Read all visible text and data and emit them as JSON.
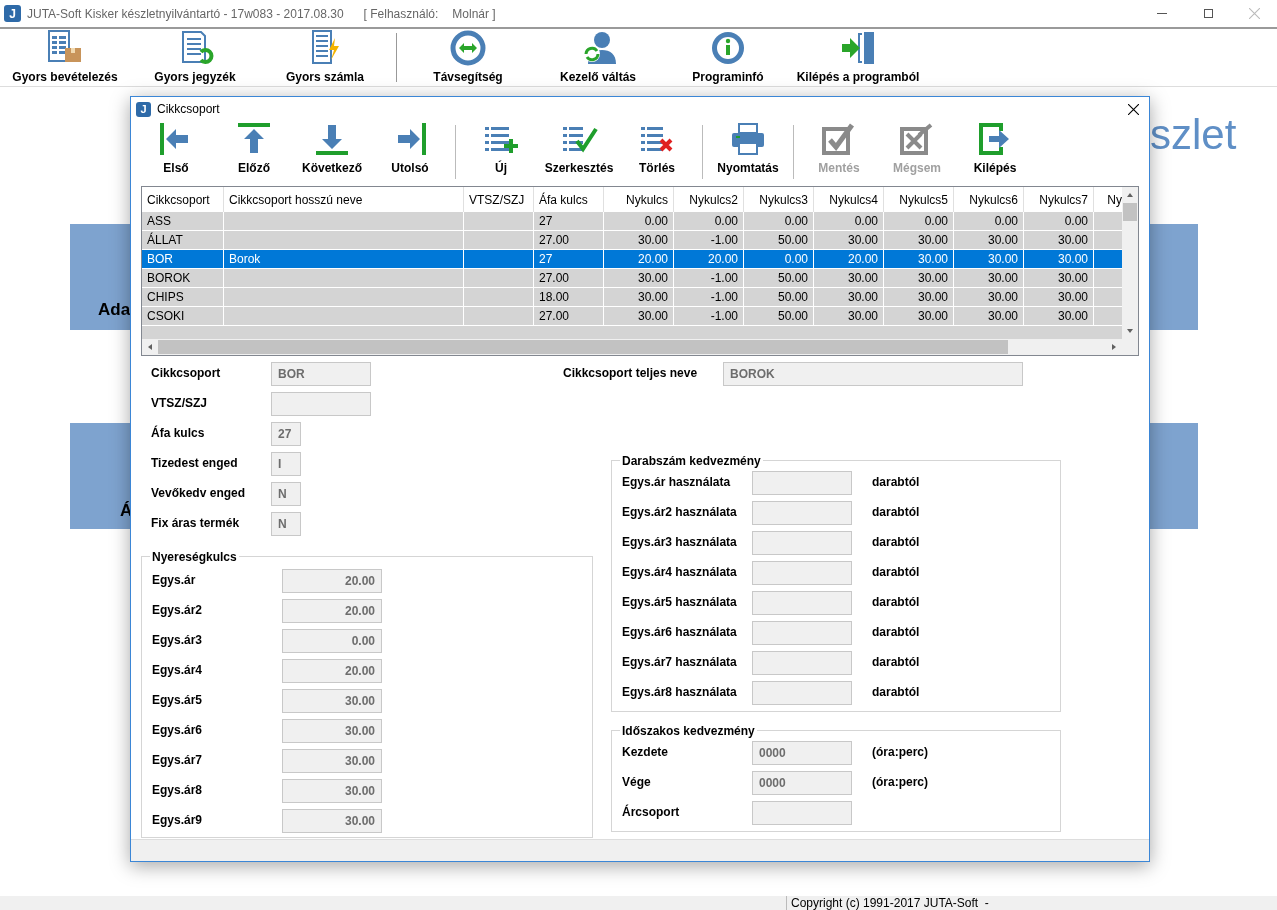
{
  "window": {
    "logo": "J",
    "title": "JUTA-Soft Kisker készletnyilvántartó - 17w083 - 2017.08.30",
    "user_label": "[ Felhasználó:",
    "user_name": "Molnár ]"
  },
  "toolbar": [
    {
      "label": "Gyors bevételezés",
      "kind": "receive",
      "separator_before": false
    },
    {
      "label": "Gyors jegyzék",
      "kind": "list",
      "separator_before": false
    },
    {
      "label": "Gyors számla",
      "kind": "invoice",
      "separator_before": false
    },
    {
      "label": "Távsegítség",
      "kind": "remote",
      "separator_before": true
    },
    {
      "label": "Kezelő váltás",
      "kind": "user",
      "separator_before": false
    },
    {
      "label": "Programinfó",
      "kind": "info",
      "separator_before": false
    },
    {
      "label": "Kilépés a programból",
      "kind": "exit",
      "separator_before": false
    }
  ],
  "background": {
    "heading_fragment": "szlet",
    "panels": [
      "Ada",
      "Á"
    ]
  },
  "dialog": {
    "logo": "J",
    "title": "Cikkcsoport",
    "toolbar": [
      {
        "label": "Első",
        "kind": "first",
        "disabled": false,
        "separator_before": false
      },
      {
        "label": "Előző",
        "kind": "prev",
        "disabled": false,
        "separator_before": false
      },
      {
        "label": "Következő",
        "kind": "next",
        "disabled": false,
        "separator_before": false
      },
      {
        "label": "Utolsó",
        "kind": "last",
        "disabled": false,
        "separator_before": false
      },
      {
        "label": "Új",
        "kind": "new",
        "disabled": false,
        "separator_before": true
      },
      {
        "label": "Szerkesztés",
        "kind": "edit",
        "disabled": false,
        "separator_before": false
      },
      {
        "label": "Törlés",
        "kind": "delete",
        "disabled": false,
        "separator_before": false
      },
      {
        "label": "Nyomtatás",
        "kind": "print",
        "disabled": false,
        "separator_before": true
      },
      {
        "label": "Mentés",
        "kind": "save",
        "disabled": true,
        "separator_before": true
      },
      {
        "label": "Mégsem",
        "kind": "cancel",
        "disabled": true,
        "separator_before": false
      },
      {
        "label": "Kilépés",
        "kind": "exit",
        "disabled": false,
        "separator_before": false
      }
    ],
    "table": {
      "columns": [
        "Cikkcsoport",
        "Cikkcsoport hosszú neve",
        "VTSZ/SZJ",
        "Áfa kulcs",
        "Nykulcs",
        "Nykulcs2",
        "Nykulcs3",
        "Nykulcs4",
        "Nykulcs5",
        "Nykulcs6",
        "Nykulcs7",
        "Ny"
      ],
      "rows": [
        {
          "selected": false,
          "cells": [
            "ASS",
            null,
            null,
            "27",
            "0.00",
            "0.00",
            "0.00",
            "0.00",
            "0.00",
            "0.00",
            "0.00",
            null
          ]
        },
        {
          "selected": false,
          "cells": [
            "ÁLLAT",
            null,
            null,
            "27.00",
            "30.00",
            "-1.00",
            "50.00",
            "30.00",
            "30.00",
            "30.00",
            "30.00",
            null
          ]
        },
        {
          "selected": true,
          "cells": [
            "BOR",
            "Borok",
            null,
            "27",
            "20.00",
            "20.00",
            "0.00",
            "20.00",
            "30.00",
            "30.00",
            "30.00",
            null
          ]
        },
        {
          "selected": false,
          "cells": [
            "BOROK",
            null,
            null,
            "27.00",
            "30.00",
            "-1.00",
            "50.00",
            "30.00",
            "30.00",
            "30.00",
            "30.00",
            null
          ]
        },
        {
          "selected": false,
          "cells": [
            "CHIPS",
            null,
            null,
            "18.00",
            "30.00",
            "-1.00",
            "50.00",
            "30.00",
            "30.00",
            "30.00",
            "30.00",
            null
          ]
        },
        {
          "selected": false,
          "cells": [
            "CSOKI",
            null,
            null,
            "27.00",
            "30.00",
            "-1.00",
            "50.00",
            "30.00",
            "30.00",
            "30.00",
            "30.00",
            null
          ]
        }
      ]
    },
    "fields": [
      {
        "label": "Cikkcsoport",
        "value": "BOR",
        "kind": "long"
      },
      {
        "label": "VTSZ/SZJ",
        "kind": "long"
      },
      {
        "label": "Áfa kulcs",
        "value": "27",
        "kind": "short"
      },
      {
        "label": "Tizedest enged",
        "value": "I",
        "kind": "short"
      },
      {
        "label": "Vevőkedv enged",
        "value": "N",
        "kind": "short"
      },
      {
        "label": "Fix áras termék",
        "value": "N",
        "kind": "short"
      }
    ],
    "full_name": {
      "label": "Cikkcsoport teljes neve",
      "value": "BOROK"
    },
    "profit_group": {
      "title": "Nyereségkulcs",
      "rows": [
        {
          "label": "Egys.ár",
          "value": "20.00"
        },
        {
          "label": "Egys.ár2",
          "value": "20.00"
        },
        {
          "label": "Egys.ár3",
          "value": "0.00"
        },
        {
          "label": "Egys.ár4",
          "value": "20.00"
        },
        {
          "label": "Egys.ár5",
          "value": "30.00"
        },
        {
          "label": "Egys.ár6",
          "value": "30.00"
        },
        {
          "label": "Egys.ár7",
          "value": "30.00"
        },
        {
          "label": "Egys.ár8",
          "value": "30.00"
        },
        {
          "label": "Egys.ár9",
          "value": "30.00"
        }
      ]
    },
    "quantity_discount": {
      "title": "Darabszám kedvezmény",
      "rows": [
        {
          "label": "Egys.ár használata",
          "suffix": "darabtól"
        },
        {
          "label": "Egys.ár2 használata",
          "suffix": "darabtól"
        },
        {
          "label": "Egys.ár3 használata",
          "suffix": "darabtól"
        },
        {
          "label": "Egys.ár4 használata",
          "suffix": "darabtól"
        },
        {
          "label": "Egys.ár5 használata",
          "suffix": "darabtól"
        },
        {
          "label": "Egys.ár6 használata",
          "suffix": "darabtól"
        },
        {
          "label": "Egys.ár7 használata",
          "suffix": "darabtól"
        },
        {
          "label": "Egys.ár8 használata",
          "suffix": "darabtól"
        }
      ]
    },
    "period_discount": {
      "title": "Időszakos kedvezmény",
      "rows": [
        {
          "label": "Kezdete",
          "value": "0000",
          "suffix": "(óra:perc)"
        },
        {
          "label": "Vége",
          "value": "0000",
          "suffix": "(óra:perc)"
        },
        {
          "label": "Árcsoport"
        }
      ]
    }
  },
  "status_bar": {
    "copyright": "Copyright (c) 1991-2017 JUTA-Soft  -"
  }
}
